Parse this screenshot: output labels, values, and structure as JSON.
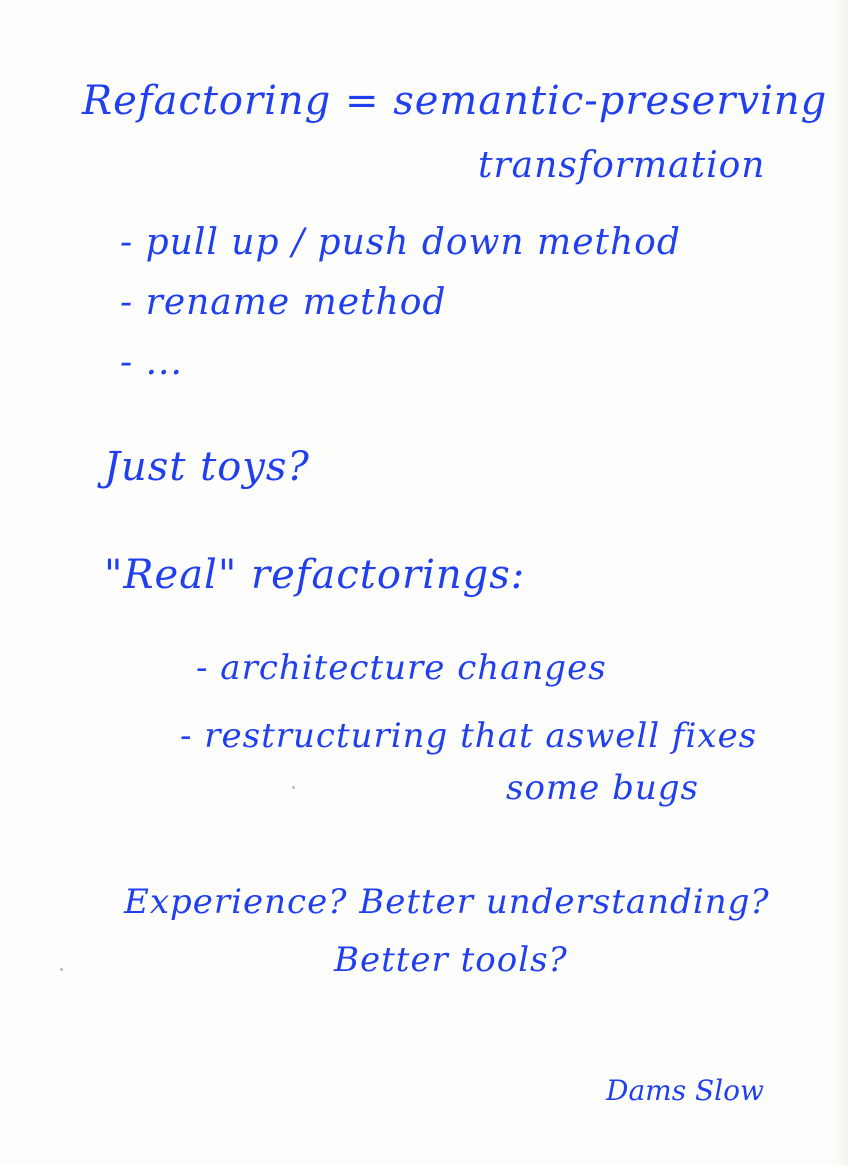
{
  "note": {
    "ink_color": "#1f3ff0",
    "paper_color": "#fdfdfb",
    "title_line_1": "Refactoring = semantic-preserving",
    "title_line_2": "transformation",
    "bullets": [
      "- pull up / push down method",
      "- rename method",
      "- ..."
    ],
    "question_1": "Just toys?",
    "heading_2": "\"Real\" refactorings:",
    "sub_bullets": [
      "- architecture changes",
      "- restructuring that aswell fixes",
      "some bugs"
    ],
    "closing_line_1": "Experience?  Better understanding?",
    "closing_line_2": "Better tools?",
    "signature": "Dams Slow"
  }
}
